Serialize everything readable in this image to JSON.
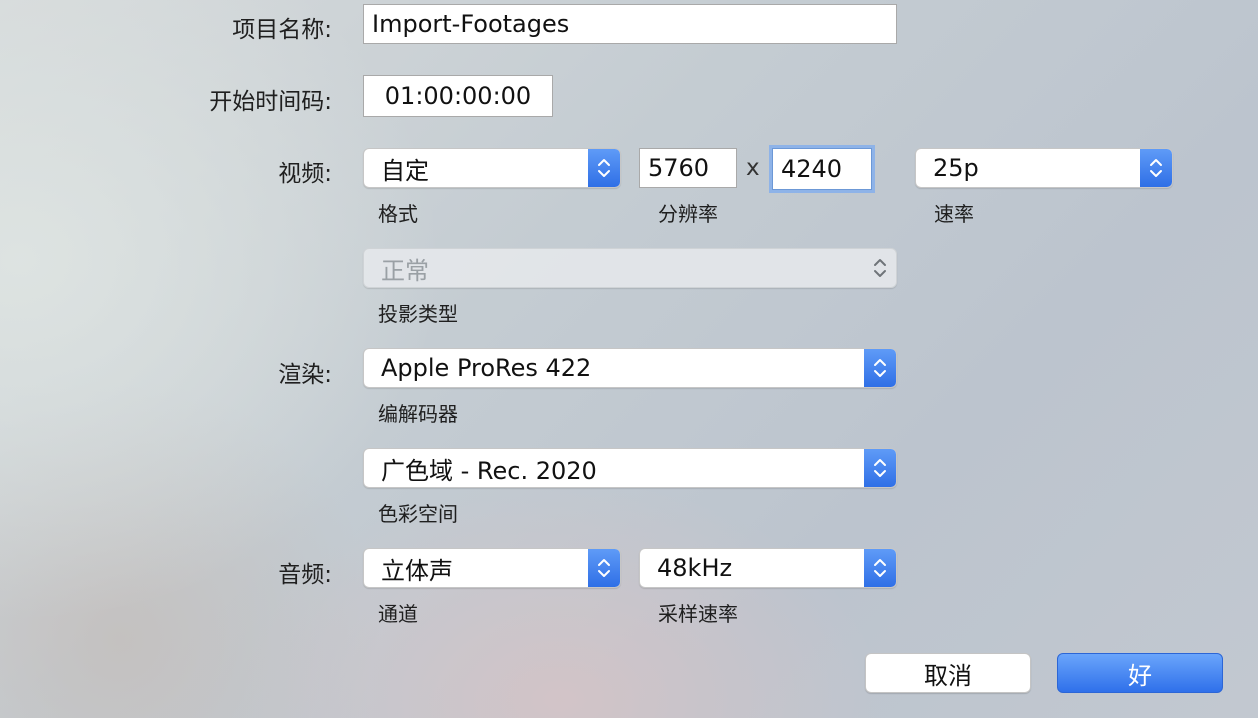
{
  "project": {
    "name_label": "项目名称:",
    "name_value": "Import-Footages",
    "timecode_label": "开始时间码:",
    "timecode_value": "01:00:00:00"
  },
  "video": {
    "label": "视频:",
    "format_value": "自定",
    "format_caption": "格式",
    "resolution_width": "5760",
    "resolution_times": "x",
    "resolution_height": "4240",
    "resolution_caption": "分辨率",
    "rate_value": "25p",
    "rate_caption": "速率",
    "projection_value": "正常",
    "projection_caption": "投影类型"
  },
  "render": {
    "label": "渲染:",
    "codec_value": "Apple ProRes 422",
    "codec_caption": "编解码器",
    "colorspace_value": "广色域 - Rec. 2020",
    "colorspace_caption": "色彩空间"
  },
  "audio": {
    "label": "音频:",
    "channels_value": "立体声",
    "channels_caption": "通道",
    "samplerate_value": "48kHz",
    "samplerate_caption": "采样速率"
  },
  "buttons": {
    "cancel_label": "取消",
    "ok_label": "好"
  },
  "colors": {
    "accent": "#2f70ea",
    "focus_ring": "#8eb3e8"
  },
  "icons": {
    "popup_stepper": "chevron-up-down-icon"
  }
}
